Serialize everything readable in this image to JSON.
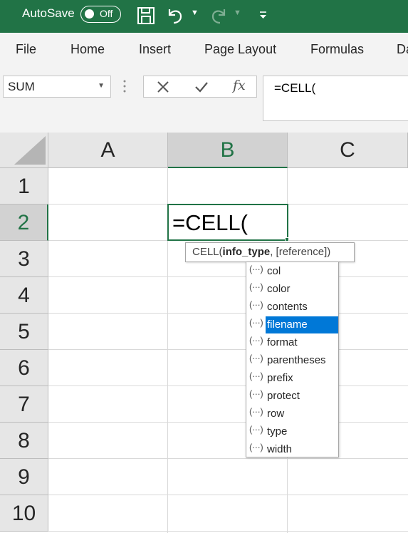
{
  "titlebar": {
    "autosave_label": "AutoSave",
    "autosave_state": "Off",
    "icons": [
      "save-icon",
      "undo-icon",
      "redo-icon",
      "customize-toolbar-icon"
    ],
    "background": "#217346"
  },
  "ribbon": {
    "tabs": [
      "File",
      "Home",
      "Insert",
      "Page Layout",
      "Formulas",
      "Da"
    ]
  },
  "formula_bar": {
    "name_box": "SUM",
    "fx_label": "fx",
    "formula": "=CELL("
  },
  "grid": {
    "columns": [
      "A",
      "B",
      "C"
    ],
    "rows": [
      "1",
      "2",
      "3",
      "4",
      "5",
      "6",
      "7",
      "8",
      "9",
      "10"
    ],
    "active_column": "B",
    "active_row": "2",
    "active_cell_text": "=CELL("
  },
  "tooltip": {
    "prefix": "CELL(",
    "bold_arg": "info_type",
    "rest": ", [reference])"
  },
  "autocomplete": {
    "icon_text": "(···)",
    "items": [
      "col",
      "color",
      "contents",
      "filename",
      "format",
      "parentheses",
      "prefix",
      "protect",
      "row",
      "type",
      "width"
    ],
    "selected": "filename",
    "selected_color": "#0078d7"
  }
}
